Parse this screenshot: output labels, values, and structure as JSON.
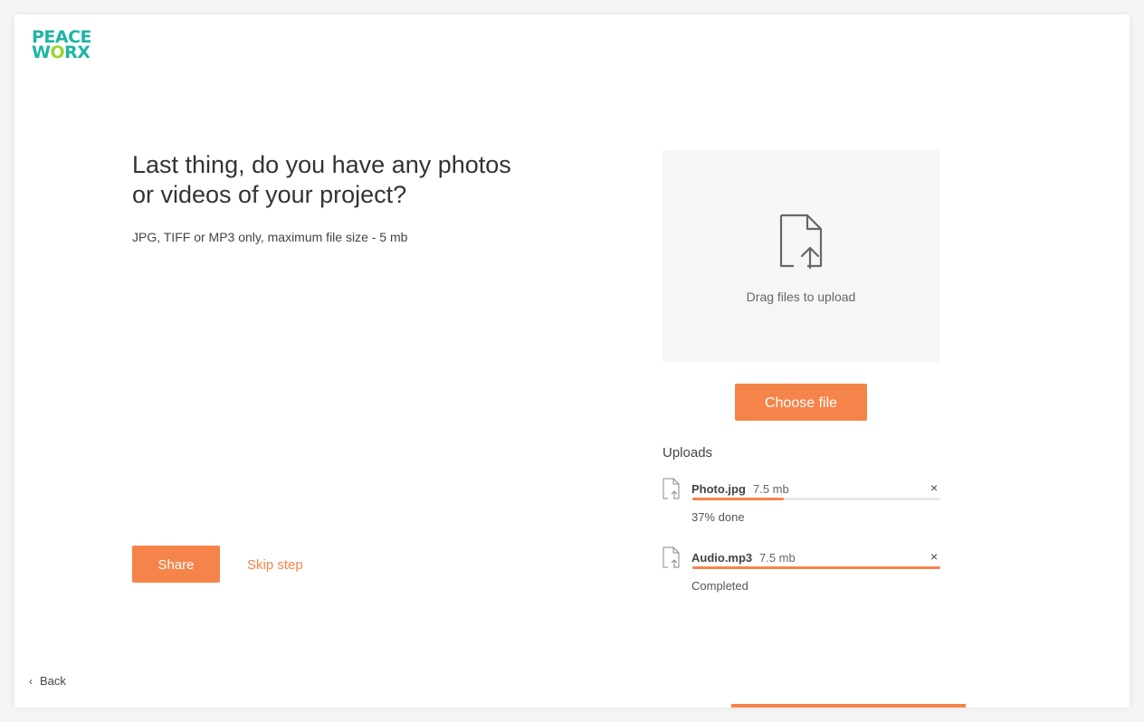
{
  "brand": {
    "logo_line1": "PEACE",
    "logo_line2_a": "W",
    "logo_line2_o": "O",
    "logo_line2_b": "RX",
    "colors": {
      "teal": "#1fb5a3",
      "lime": "#9cd22f",
      "accent": "#f5844a"
    }
  },
  "main": {
    "title": "Last thing, do you have any photos or videos of your project?",
    "subtitle": "JPG, TIFF or MP3 only, maximum file size - 5 mb"
  },
  "dropzone": {
    "icon": "file-upload-icon",
    "label": "Drag files to upload"
  },
  "choose_button": "Choose file",
  "uploads": {
    "title": "Uploads",
    "items": [
      {
        "name": "Photo.jpg",
        "size": "7.5 mb",
        "progress": 0.37,
        "status": "37% done",
        "icon": "file-upload-icon"
      },
      {
        "name": "Audio.mp3",
        "size": "7.5 mb",
        "progress": 1.0,
        "status": "Completed",
        "icon": "file-upload-icon"
      }
    ],
    "remove_symbol": "×"
  },
  "actions": {
    "share": "Share",
    "skip": "Skip step"
  },
  "nav": {
    "back": "Back",
    "back_icon": "chevron-left-icon"
  },
  "progress": {
    "step_fraction": 1.0
  }
}
